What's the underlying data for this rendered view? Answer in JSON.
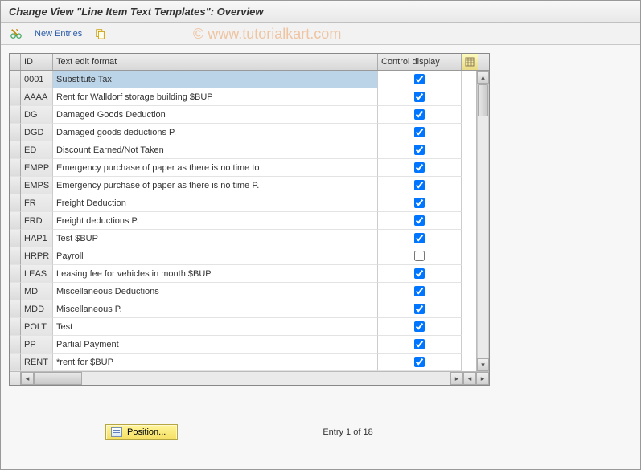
{
  "title": "Change View \"Line Item Text Templates\": Overview",
  "toolbar": {
    "new_entries_label": "New Entries"
  },
  "table": {
    "headers": {
      "id": "ID",
      "text": "Text edit format",
      "ctrl": "Control display"
    },
    "rows": [
      {
        "id": "0001",
        "text": "Substitute Tax",
        "ctrl": true,
        "selected": true
      },
      {
        "id": "AAAA",
        "text": "Rent for Walldorf storage building $BUP",
        "ctrl": true
      },
      {
        "id": "DG",
        "text": "Damaged Goods Deduction",
        "ctrl": true
      },
      {
        "id": "DGD",
        "text": "Damaged goods deductions P.",
        "ctrl": true
      },
      {
        "id": "ED",
        "text": "Discount Earned/Not Taken",
        "ctrl": true
      },
      {
        "id": "EMPP",
        "text": "Emergency purchase of paper as there is no time to",
        "ctrl": true
      },
      {
        "id": "EMPS",
        "text": "Emergency purchase of paper as there is no time P.",
        "ctrl": true
      },
      {
        "id": "FR",
        "text": "Freight Deduction",
        "ctrl": true
      },
      {
        "id": "FRD",
        "text": "Freight deductions P.",
        "ctrl": true
      },
      {
        "id": "HAP1",
        "text": "Test $BUP",
        "ctrl": true
      },
      {
        "id": "HRPR",
        "text": "Payroll",
        "ctrl": false
      },
      {
        "id": "LEAS",
        "text": "Leasing fee for vehicles in month $BUP",
        "ctrl": true
      },
      {
        "id": "MD",
        "text": "Miscellaneous Deductions",
        "ctrl": true
      },
      {
        "id": "MDD",
        "text": "Miscellaneous P.",
        "ctrl": true
      },
      {
        "id": "POLT",
        "text": "Test",
        "ctrl": true
      },
      {
        "id": "PP",
        "text": "Partial Payment",
        "ctrl": true
      },
      {
        "id": "RENT",
        "text": "*rent for $BUP",
        "ctrl": true
      }
    ]
  },
  "footer": {
    "position_label": "Position...",
    "entry_text": "Entry 1 of 18"
  },
  "watermark": "© www.tutorialkart.com"
}
